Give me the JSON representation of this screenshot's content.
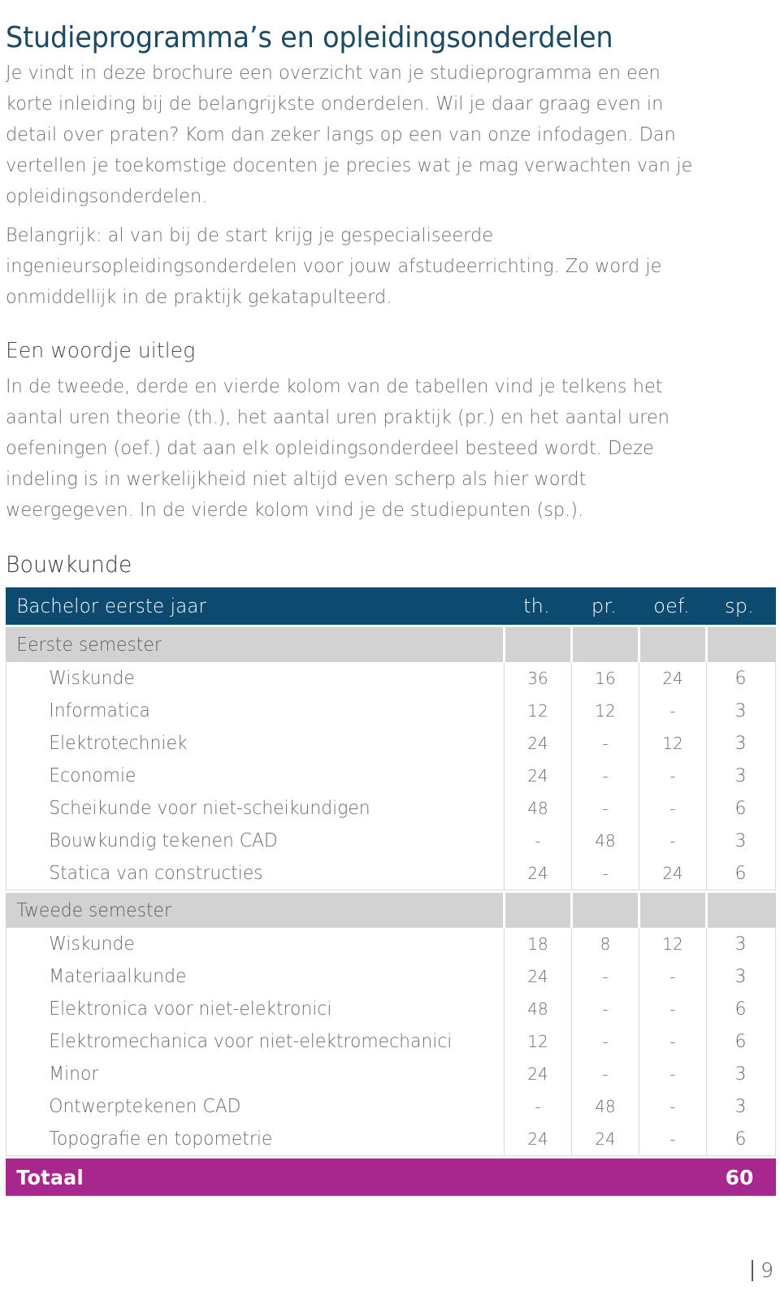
{
  "document": {
    "title": "Studieprogramma’s en opleidingsonderdelen",
    "intro_paragraph_1": "Je vindt in deze brochure een overzicht van je studieprogramma en een korte inleiding bij de belangrijkste onderdelen. Wil je daar graag even in detail over praten? Kom dan zeker langs op een van onze infodagen. Dan vertellen je toekomstige docenten je precies wat je mag verwachten van je opleidingsonderdelen.",
    "intro_paragraph_2": "Belangrijk: al van bij de start krijg je gespecialiseerde ingenieursopleidingsonderdelen voor jouw afstudeerrichting. Zo word je onmiddellijk in de praktijk gekatapulteerd.",
    "uitleg_heading": "Een woordje uitleg",
    "uitleg_paragraph": "In de tweede, derde en vierde kolom van de tabellen vind je telkens het aantal uren theorie (th.), het aantal uren praktijk (pr.) en het aantal uren oefeningen (oef.) dat aan elk opleidingsonderdeel besteed wordt. Deze indeling is in werkelijkheid niet altijd even scherp als hier wordt weergegeven. In de vierde kolom vind je de studiepunten (sp.).",
    "program_title": "Bouwkunde"
  },
  "colors": {
    "title_blue": "#1c4a63",
    "table_header_blue": "#0d4a70",
    "band_gray": "#d2d2d2",
    "total_magenta": "#a8278f",
    "body_gray": "#6e6e6e"
  },
  "table": {
    "header": {
      "name": "Bachelor eerste jaar",
      "th": "th.",
      "pr": "pr.",
      "oef": "oef.",
      "sp": "sp."
    },
    "sections": [
      {
        "band": "Eerste semester",
        "rows": [
          {
            "name": "Wiskunde",
            "th": "36",
            "pr": "16",
            "oef": "24",
            "sp": "6"
          },
          {
            "name": "Informatica",
            "th": "12",
            "pr": "12",
            "oef": "-",
            "sp": "3"
          },
          {
            "name": "Elektrotechniek",
            "th": "24",
            "pr": "-",
            "oef": "12",
            "sp": "3"
          },
          {
            "name": "Economie",
            "th": "24",
            "pr": "-",
            "oef": "-",
            "sp": "3"
          },
          {
            "name": "Scheikunde voor niet-scheikundigen",
            "th": "48",
            "pr": "-",
            "oef": "-",
            "sp": "6"
          },
          {
            "name": "Bouwkundig tekenen CAD",
            "th": "-",
            "pr": "48",
            "oef": "-",
            "sp": "3"
          },
          {
            "name": "Statica van constructies",
            "th": "24",
            "pr": "-",
            "oef": "24",
            "sp": "6"
          }
        ]
      },
      {
        "band": "Tweede semester",
        "rows": [
          {
            "name": "Wiskunde",
            "th": "18",
            "pr": "8",
            "oef": "12",
            "sp": "3"
          },
          {
            "name": "Materiaalkunde",
            "th": "24",
            "pr": "-",
            "oef": "-",
            "sp": "3"
          },
          {
            "name": "Elektronica voor niet-elektronici",
            "th": "48",
            "pr": "-",
            "oef": "-",
            "sp": "6"
          },
          {
            "name": "Elektromechanica voor niet-elektromechanici",
            "th": "12",
            "pr": "-",
            "oef": "-",
            "sp": "6"
          },
          {
            "name": "Minor",
            "th": "24",
            "pr": "-",
            "oef": "-",
            "sp": "3"
          },
          {
            "name": "Ontwerptekenen CAD",
            "th": "-",
            "pr": "48",
            "oef": "-",
            "sp": "3"
          },
          {
            "name": "Topografie en topometrie",
            "th": "24",
            "pr": "24",
            "oef": "-",
            "sp": "6"
          }
        ]
      }
    ],
    "total": {
      "label": "Totaal",
      "th": "",
      "pr": "",
      "oef": "",
      "sp": "60"
    }
  },
  "footer": {
    "page_number": "9"
  }
}
